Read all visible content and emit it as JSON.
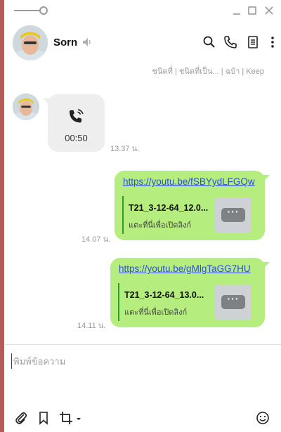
{
  "contact": {
    "name": "Sorn"
  },
  "chat": {
    "truncated_line": "ชนิดที่ | ชนิดที่เป็น... | ฉบ้า | Keep",
    "call": {
      "duration": "00:50",
      "time": "13.37 น."
    },
    "links": [
      {
        "url": "https://youtu.be/fSBYydLFGQw",
        "title": "T21_3-12-64_12.0...",
        "subtitle": "แตะที่นี่เพื่อเปิดลิงก์",
        "time": "14.07 น."
      },
      {
        "url": "https://youtu.be/gMlgTaGG7HU",
        "title": "T21_3-12-64_13.0...",
        "subtitle": "แตะที่นี่เพื่อเปิดลิงก์",
        "time": "14.11 น."
      }
    ]
  },
  "input": {
    "placeholder": "พิมพ์ข้อความ",
    "value": ""
  },
  "icons": {
    "window": [
      "pin-slider-icon",
      "minimize-icon",
      "maximize-icon",
      "close-icon"
    ],
    "header": [
      "speaker-icon",
      "search-icon",
      "phone-icon",
      "notes-icon",
      "more-vertical-icon"
    ],
    "toolbar": [
      "paperclip-icon",
      "bookmark-icon",
      "crop-icon",
      "chevron-down-icon",
      "emoji-icon"
    ]
  },
  "colors": {
    "outgoing_bubble": "#b5ed7f",
    "incoming_bubble": "#eeeeee",
    "link": "#2b4fd6",
    "preview_bar": "#2a9d2a",
    "icon_gray": "#9a9a9a"
  }
}
